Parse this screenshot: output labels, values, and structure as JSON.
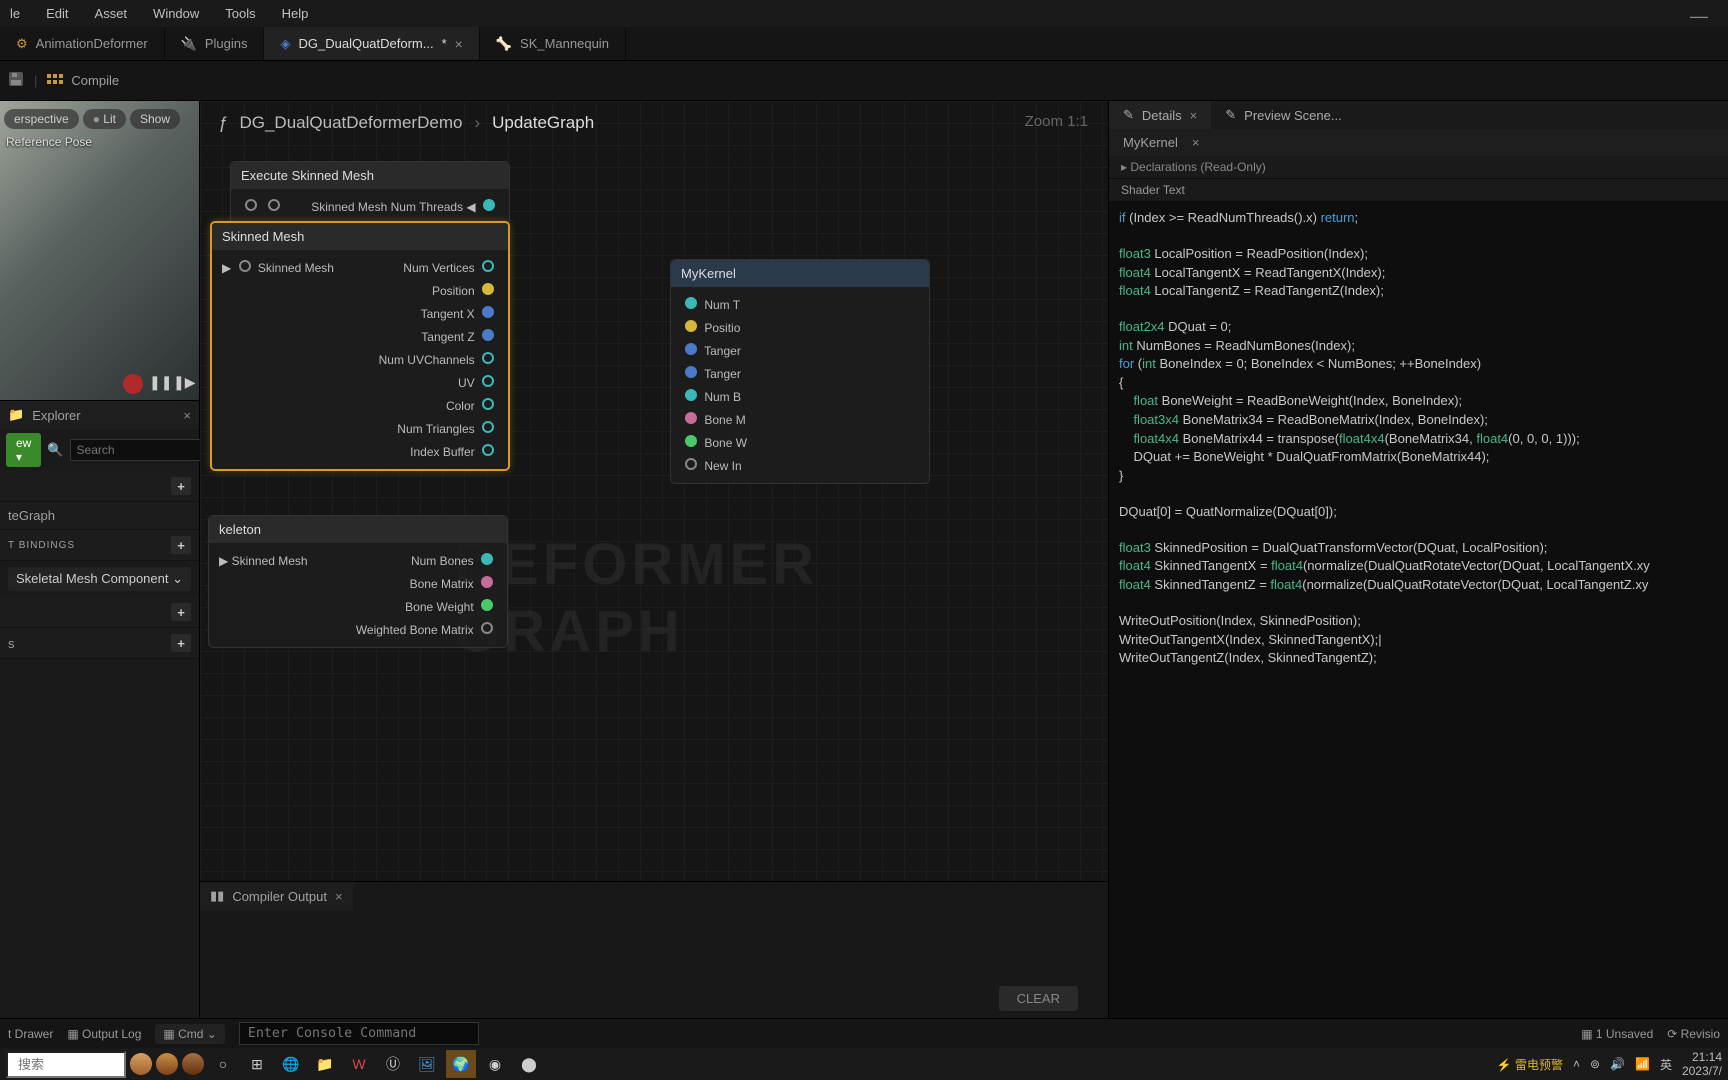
{
  "menu": {
    "file": "le",
    "edit": "Edit",
    "asset": "Asset",
    "window": "Window",
    "tools": "Tools",
    "help": "Help"
  },
  "tabs": [
    {
      "label": "AnimationDeformer",
      "active": false
    },
    {
      "label": "Plugins",
      "active": false
    },
    {
      "label": "DG_DualQuatDeform...",
      "active": true,
      "dirty": "*"
    },
    {
      "label": "SK_Mannequin",
      "active": false
    }
  ],
  "toolbar": {
    "compile": "Compile"
  },
  "viewport": {
    "persp": "erspective",
    "lit": "Lit",
    "show": "Show",
    "pose": "Reference Pose"
  },
  "explorer": {
    "title": "Explorer",
    "new": "ew",
    "search": "Search",
    "graph": "teGraph",
    "bindings": "T BINDINGS",
    "component": "Skeletal Mesh Component",
    "last": "s"
  },
  "breadcrumb": {
    "fn": "ƒ",
    "a": "DG_DualQuatDeformerDemo",
    "b": "UpdateGraph",
    "zoom": "Zoom 1:1"
  },
  "nodes": {
    "exec": {
      "title": "Execute Skinned Mesh",
      "row1": "Skinned Mesh Num Threads"
    },
    "mesh": {
      "title": "Skinned Mesh",
      "in": "Skinned Mesh",
      "outs": [
        "Num Vertices",
        "Position",
        "Tangent X",
        "Tangent Z",
        "Num UVChannels",
        "UV",
        "Color",
        "Num Triangles",
        "Index Buffer"
      ]
    },
    "skel": {
      "title": "keleton",
      "in": "Skinned Mesh",
      "outs": [
        "Num Bones",
        "Bone Matrix",
        "Bone Weight",
        "Weighted Bone Matrix"
      ]
    },
    "kernel": {
      "title": "MyKernel",
      "ins": [
        "Num T",
        "Positio",
        "Tanger",
        "Tanger",
        "Num B",
        "Bone M",
        "Bone W",
        "New In"
      ]
    }
  },
  "watermark": "DEFORMER GRAPH",
  "compiler": {
    "title": "Compiler Output",
    "clear": "CLEAR"
  },
  "right": {
    "details": "Details",
    "preview": "Preview Scene...",
    "kernel": "MyKernel",
    "decl": "Declarations (Read-Only)",
    "shader": "Shader Text"
  },
  "code": {
    "l1a": "if",
    "l1b": " (Index >= ReadNumThreads().x) ",
    "l1c": "return",
    "l1d": ";",
    "l2a": "float3",
    "l2b": " LocalPosition = ReadPosition(Index);",
    "l3a": "float4",
    "l3b": " LocalTangentX = ReadTangentX(Index);",
    "l4a": "float4",
    "l4b": " LocalTangentZ = ReadTangentZ(Index);",
    "l5a": "float2x4",
    "l5b": " DQuat = 0;",
    "l6a": "int",
    "l6b": " NumBones = ReadNumBones(Index);",
    "l7a": "for",
    "l7b": " (",
    "l7c": "int",
    "l7d": " BoneIndex = 0; BoneIndex < NumBones; ++BoneIndex)",
    "l8": "{",
    "l9a": "    float",
    "l9b": " BoneWeight = ReadBoneWeight(Index, BoneIndex);",
    "l10a": "    float3x4",
    "l10b": " BoneMatrix34 = ReadBoneMatrix(Index, BoneIndex);",
    "l11a": "    float4x4",
    "l11b": " BoneMatrix44 = transpose(",
    "l11c": "float4x4",
    "l11d": "(BoneMatrix34, ",
    "l11e": "float4",
    "l11f": "(0, 0, 0, 1)));",
    "l12": "    DQuat += BoneWeight * DualQuatFromMatrix(BoneMatrix44);",
    "l13": "}",
    "l14": "DQuat[0] = QuatNormalize(DQuat[0]);",
    "l15a": "float3",
    "l15b": " SkinnedPosition = DualQuatTransformVector(DQuat, LocalPosition);",
    "l16a": "float4",
    "l16b": " SkinnedTangentX = ",
    "l16c": "float4",
    "l16d": "(normalize(DualQuatRotateVector(DQuat, LocalTangentX.xy",
    "l17a": "float4",
    "l17b": " SkinnedTangentZ = ",
    "l17c": "float4",
    "l17d": "(normalize(DualQuatRotateVector(DQuat, LocalTangentZ.xy",
    "l18": "WriteOutPosition(Index, SkinnedPosition);",
    "l19": "WriteOutTangentX(Index, SkinnedTangentX);|",
    "l20": "WriteOutTangentZ(Index, SkinnedTangentZ);"
  },
  "status": {
    "drawer": "t Drawer",
    "log": "Output Log",
    "cmd": "Cmd",
    "console": "Enter Console Command",
    "unsaved": "1 Unsaved",
    "rev": "Revisio"
  },
  "taskbar": {
    "search": "搜索",
    "weather": "雷电预警",
    "ime": "英",
    "time": "21:14",
    "date": "2023/7/"
  }
}
